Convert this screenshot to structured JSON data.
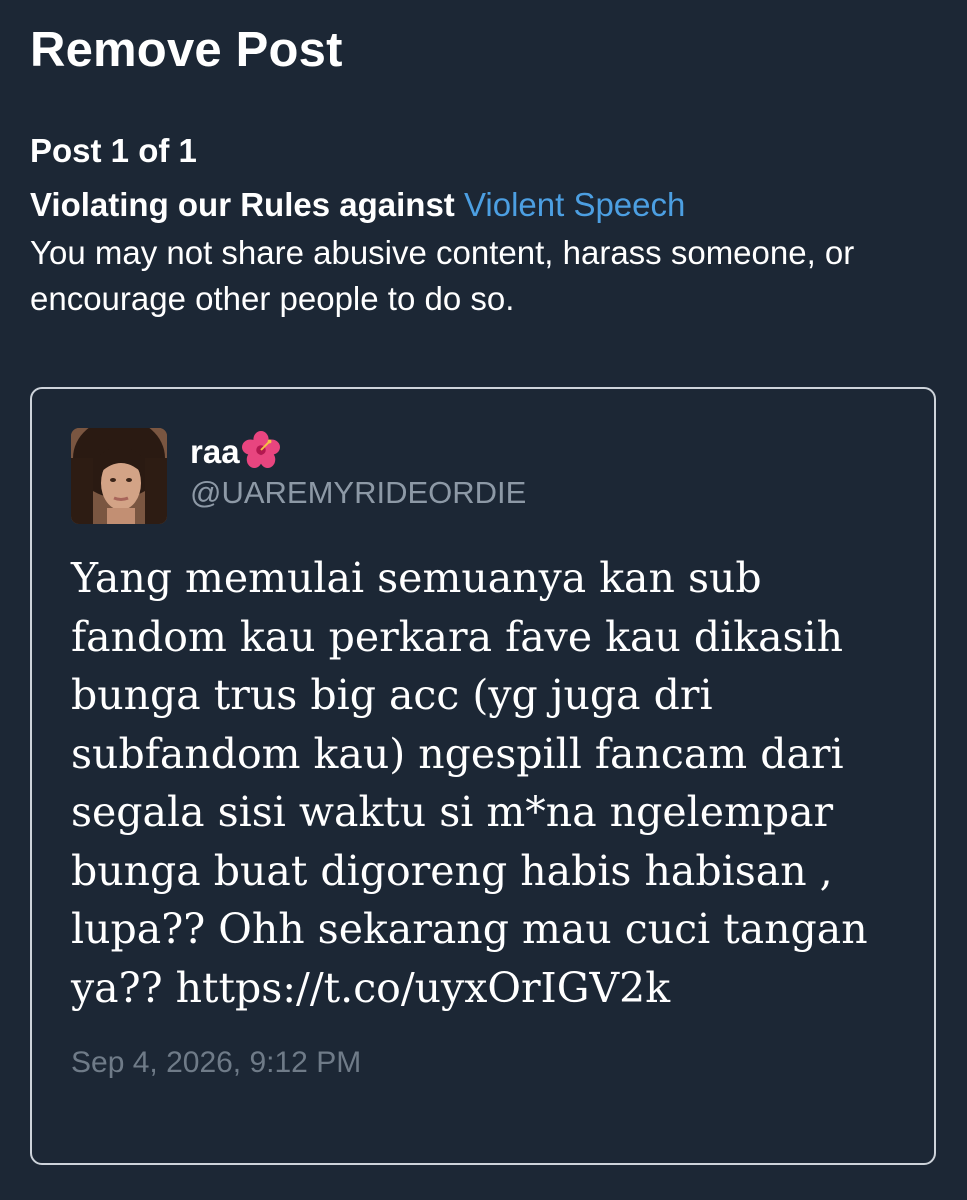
{
  "header": {
    "title": "Remove Post"
  },
  "violation": {
    "counter": "Post 1 of 1",
    "rule_prefix": "Violating our Rules against ",
    "rule_name": "Violent Speech",
    "description": "You may not share abusive content, harass someone, or encourage other people to do so."
  },
  "post": {
    "display_name": "raa",
    "name_emoji_icon": "hibiscus-icon",
    "handle": "@UAREMYRIDEORDIE",
    "body": "Yang memulai semuanya kan sub\nfandom kau perkara fave kau dikasih\nbunga trus big acc (yg juga dri\nsubfandom kau) ngespill fancam dari\nsegala sisi waktu si m*na ngelempar\nbunga buat digoreng habis habisan ,\nlupa?? Ohh sekarang mau cuci tangan\nya?? https://t.co/uyxOrIGV2k",
    "timestamp": "Sep 4, 2026, 9:12 PM"
  },
  "colors": {
    "background": "#1c2735",
    "link": "#4c9fe2",
    "muted": "#8d99a6",
    "card_border": "#cdd3da"
  }
}
